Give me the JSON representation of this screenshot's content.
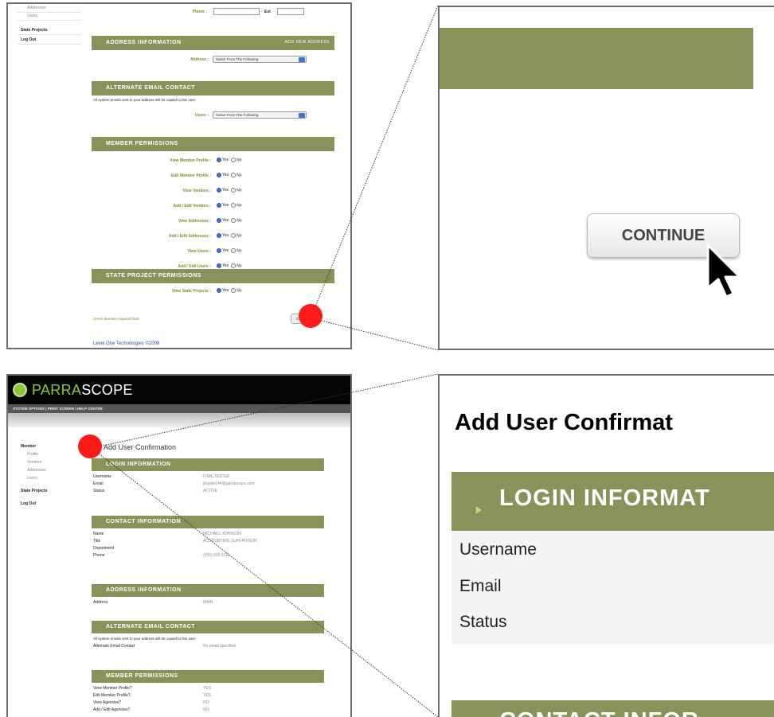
{
  "top_left": {
    "sidebar": {
      "items": [
        {
          "label": "Addresses",
          "type": "sub"
        },
        {
          "label": "Users",
          "type": "sub"
        },
        {
          "label": "State Projects",
          "type": "main"
        },
        {
          "label": "Log Out",
          "type": "main"
        }
      ]
    },
    "phone_label": "Phone :",
    "ext_label": "Ext",
    "address_section": {
      "title": "ADDRESS INFORMATION",
      "action": "ADD NEW ADDRESS",
      "field_label": "Address :",
      "select_value": "Select From The Following"
    },
    "alt_email_section": {
      "title": "ALTERNATE EMAIL CONTACT",
      "note": "All system emails sent to your address will be copied to this user.",
      "field_label": "Users :",
      "select_value": "Select From The Following"
    },
    "member_permissions": {
      "title": "MEMBER PERMISSIONS",
      "rows": [
        {
          "label": "View Member Profile :"
        },
        {
          "label": "Edit Member Profile :"
        },
        {
          "label": "View Vendors :"
        },
        {
          "label": "Add / Edit Vendors :"
        },
        {
          "label": "View Addresses :"
        },
        {
          "label": "Add / Edit Addresses :"
        },
        {
          "label": "View Users :"
        },
        {
          "label": "Add / Edit Users :"
        }
      ],
      "yes": "Yes",
      "no": "No"
    },
    "state_permissions": {
      "title": "STATE PROJECT PERMISSIONS",
      "rows": [
        {
          "label": "View State Projects :"
        }
      ]
    },
    "required_note": "Green denotes required field",
    "continue_label": "Continue",
    "footer": "Level One Technologies ©2009"
  },
  "top_right": {
    "continue_label": "CONTINUE"
  },
  "bottom_left": {
    "brand_prefix": "PARRA",
    "brand_suffix": "SCOPE",
    "nav": "SYSTEM OPTIONS  |  PRINT SCREEN  |  HELP CENTER",
    "sidebar": {
      "items": [
        {
          "label": "Member",
          "type": "main"
        },
        {
          "label": "Profile",
          "type": "sub"
        },
        {
          "label": "Vendors",
          "type": "sub"
        },
        {
          "label": "Addresses",
          "type": "sub"
        },
        {
          "label": "Users",
          "type": "sub"
        },
        {
          "label": "State Projects",
          "type": "main"
        },
        {
          "label": "Log Out",
          "type": "main"
        }
      ]
    },
    "page_title": "Add User Confirmation",
    "login": {
      "title": "LOGIN INFORMATION",
      "rows": [
        {
          "k": "Username",
          "v": "FINALTESTER"
        },
        {
          "k": "Email",
          "v": "jtruster144@parrascope.com"
        },
        {
          "k": "Status",
          "v": "ACTIVE"
        }
      ]
    },
    "contact": {
      "title": "CONTACT INFORMATION",
      "rows": [
        {
          "k": "Name",
          "v": "MICHAEL JOHNSON"
        },
        {
          "k": "Title",
          "v": "ACCOUNTING SUPERVISOR"
        },
        {
          "k": "Department",
          "v": ""
        },
        {
          "k": "Phone",
          "v": "(555) 555-1111"
        }
      ]
    },
    "address": {
      "title": "ADDRESS INFORMATION",
      "rows": [
        {
          "k": "Address",
          "v": "MAIN"
        }
      ]
    },
    "alt_email": {
      "title": "ALTERNATE EMAIL CONTACT",
      "note": "All system emails sent to your address will be copied to this user.",
      "rows": [
        {
          "k": "Alternate Email Contact",
          "v": "No email specified"
        }
      ]
    },
    "perms": {
      "title": "MEMBER PERMISSIONS",
      "rows": [
        {
          "k": "View Member Profile?",
          "v": "YES"
        },
        {
          "k": "Edit Member Profile?",
          "v": "YES"
        },
        {
          "k": "View Agencies?",
          "v": "NO"
        },
        {
          "k": "Add / Edit Agencies?",
          "v": "NO"
        }
      ]
    }
  },
  "bottom_right": {
    "page_title": "Add User Confirmat",
    "section1": "LOGIN INFORMAT",
    "fields": [
      "Username",
      "Email",
      "Status"
    ],
    "section2": "CONTACT INFOR"
  },
  "colors": {
    "olive": "#8a9159",
    "marker": "#ff1a1a",
    "brand_green": "#8ec43e"
  }
}
